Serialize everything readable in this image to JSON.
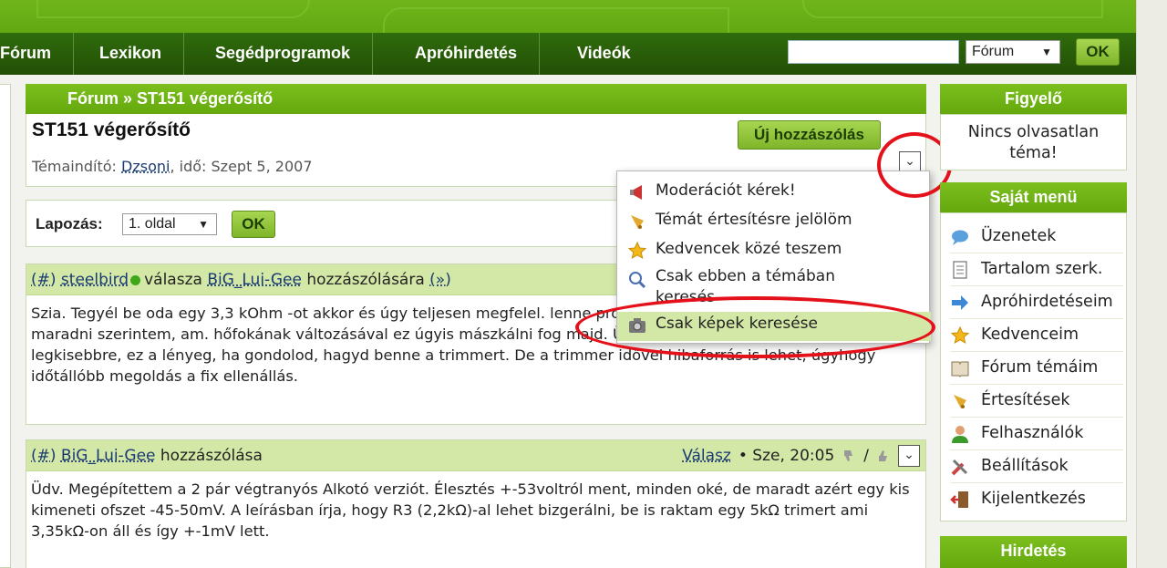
{
  "nav": {
    "items": [
      "Fórum",
      "Lexikon",
      "Segédprogramok",
      "Apróhirdetés",
      "Videók"
    ],
    "search_value": "",
    "search_scope": "Fórum",
    "ok_label": "OK"
  },
  "breadcrumb": "Fórum » ST151 végerősítő",
  "topic": {
    "title": "ST151 végerősítő",
    "starter_label": "Témaindító:",
    "starter": "Dzsoni",
    "date_label": ", idő: Szept 5, 2007",
    "new_post_label": "Új hozzászólás"
  },
  "paging": {
    "label": "Lapozás:",
    "selected": "1. oldal",
    "ok_label": "OK"
  },
  "dropdown": {
    "items": [
      {
        "icon": "megaphone-icon",
        "label": "Moderációt kérek!"
      },
      {
        "icon": "bell-icon",
        "label": "Témát értesítésre jelölöm"
      },
      {
        "icon": "star-icon",
        "label": "Kedvencek közé teszem"
      },
      {
        "icon": "search-icon",
        "label": "Csak ebben a témában keresés"
      },
      {
        "icon": "camera-icon",
        "label": "Csak képek keresése"
      }
    ]
  },
  "posts": [
    {
      "hash": "(#)",
      "author": "steelbird",
      "reply_text": "válasza",
      "reply_to": "BiG_Lui-Gee",
      "reply_suffix": "hozzászólására",
      "arrow": "(»)",
      "body": "Szia. Tegyél be oda egy 3,3 kOhm -ot akkor és úgy teljesen megfelel. lenne probléma, a 3,3k-val pedig 5mV alatt fog maradni szerintem, am. hőfokának változásával ez úgyis mászkálni fog majd. Üzemmeleg állapotban állítsd a legkisebbre, ez a lényeg, ha gondolod, hagyd benne a trimmert. De a trimmer idővel hibaforrás is lehet, úgyhogy időtállóbb megoldás a fix ellenállás."
    },
    {
      "hash": "(#)",
      "author": "BiG_Lui-Gee",
      "reply_suffix": "hozzászólása",
      "reply_link": "Válasz",
      "time": "• Sze, 20:05",
      "slash": "/",
      "body": "Üdv. Megépítettem a 2 pár végtranyós Alkotó verziót. Élesztés +-53voltról ment, minden oké, de maradt azért egy kis kimeneti ofszet -45-50mV. A leírásban írja, hogy R3 (2,2kΩ)-al lehet bizgerálni, be is raktam egy 5kΩ trimert ami 3,35kΩ-on áll és így +-1mV lett."
    }
  ],
  "sidebar": {
    "watch_title": "Figyelő",
    "watch_text": "Nincs olvasatlan téma!",
    "menu_title": "Saját menü",
    "menu_items": [
      {
        "icon": "speech-bubble-icon",
        "label": "Üzenetek"
      },
      {
        "icon": "document-icon",
        "label": "Tartalom szerk."
      },
      {
        "icon": "arrow-right-icon",
        "label": "Apróhirdetéseim"
      },
      {
        "icon": "star-icon",
        "label": "Kedvenceim"
      },
      {
        "icon": "book-icon",
        "label": "Fórum témáim"
      },
      {
        "icon": "bell-icon",
        "label": "Értesítések"
      },
      {
        "icon": "user-icon",
        "label": "Felhasználók"
      },
      {
        "icon": "tools-icon",
        "label": "Beállítások"
      },
      {
        "icon": "exit-door-icon",
        "label": "Kijelentkezés"
      }
    ],
    "ads_title": "Hirdetés"
  },
  "colors": {
    "brand_green": "#64a80d",
    "nav_dark": "#234f06",
    "highlight": "#d3e8a6",
    "annotation_red": "#e4111a"
  }
}
